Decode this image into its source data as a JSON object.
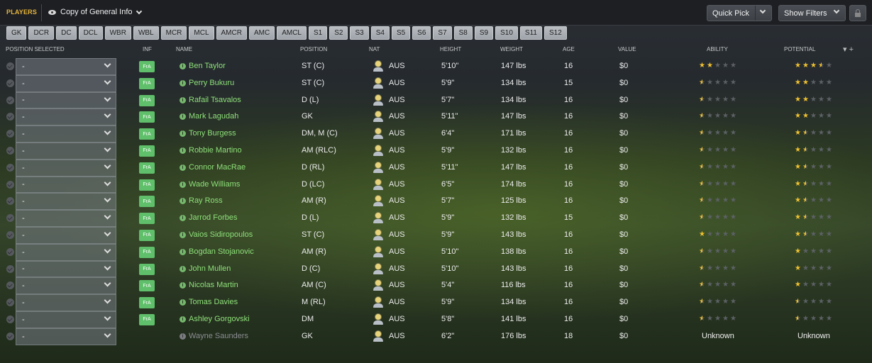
{
  "header": {
    "section": "PLAYERS",
    "view_name": "Copy of General Info",
    "quick_pick": "Quick Pick",
    "show_filters": "Show Filters"
  },
  "position_filters": [
    "GK",
    "DCR",
    "DC",
    "DCL",
    "WBR",
    "WBL",
    "MCR",
    "MCL",
    "AMCR",
    "AMC",
    "AMCL",
    "S1",
    "S2",
    "S3",
    "S4",
    "S5",
    "S6",
    "S7",
    "S8",
    "S9",
    "S10",
    "S11",
    "S12"
  ],
  "columns": {
    "position_selected": "POSITION SELECTED",
    "inf": "INF",
    "name": "NAME",
    "position": "POSITION",
    "nat": "NAT",
    "height": "HEIGHT",
    "weight": "WEIGHT",
    "age": "AGE",
    "value": "VALUE",
    "ability": "ABILITY",
    "potential": "POTENTIAL"
  },
  "accent_colors": {
    "header_label": "#e8b53a",
    "player_name": "#8ee07a",
    "star": "#f0c230",
    "inf_badge": "#5fbf6a"
  },
  "players": [
    {
      "selected": "-",
      "inf": "FrA",
      "name": "Ben Taylor",
      "position": "ST (C)",
      "nat": "AUS",
      "height": "5'10\"",
      "weight": "147 lbs",
      "age": "16",
      "value": "$0",
      "ability": 2,
      "potential": 3.5
    },
    {
      "selected": "-",
      "inf": "FrA",
      "name": "Perry Bukuru",
      "position": "ST (C)",
      "nat": "AUS",
      "height": "5'9\"",
      "weight": "134 lbs",
      "age": "15",
      "value": "$0",
      "ability": 0.5,
      "potential": 2
    },
    {
      "selected": "-",
      "inf": "FrA",
      "name": "Rafail Tsavalos",
      "position": "D (L)",
      "nat": "AUS",
      "height": "5'7\"",
      "weight": "134 lbs",
      "age": "16",
      "value": "$0",
      "ability": 0.5,
      "potential": 2
    },
    {
      "selected": "-",
      "inf": "FrA",
      "name": "Mark Lagudah",
      "position": "GK",
      "nat": "AUS",
      "height": "5'11\"",
      "weight": "147 lbs",
      "age": "16",
      "value": "$0",
      "ability": 0.5,
      "potential": 2
    },
    {
      "selected": "-",
      "inf": "FrA",
      "name": "Tony Burgess",
      "position": "DM, M (C)",
      "nat": "AUS",
      "height": "6'4\"",
      "weight": "171 lbs",
      "age": "16",
      "value": "$0",
      "ability": 0.5,
      "potential": 1.5
    },
    {
      "selected": "-",
      "inf": "FrA",
      "name": "Robbie Martino",
      "position": "AM (RLC)",
      "nat": "AUS",
      "height": "5'9\"",
      "weight": "132 lbs",
      "age": "16",
      "value": "$0",
      "ability": 0.5,
      "potential": 1.5
    },
    {
      "selected": "-",
      "inf": "FrA",
      "name": "Connor MacRae",
      "position": "D (RL)",
      "nat": "AUS",
      "height": "5'11\"",
      "weight": "147 lbs",
      "age": "16",
      "value": "$0",
      "ability": 0.5,
      "potential": 1.5
    },
    {
      "selected": "-",
      "inf": "FrA",
      "name": "Wade Williams",
      "position": "D (LC)",
      "nat": "AUS",
      "height": "6'5\"",
      "weight": "174 lbs",
      "age": "16",
      "value": "$0",
      "ability": 0.5,
      "potential": 1.5
    },
    {
      "selected": "-",
      "inf": "FrA",
      "name": "Ray Ross",
      "position": "AM (R)",
      "nat": "AUS",
      "height": "5'7\"",
      "weight": "125 lbs",
      "age": "16",
      "value": "$0",
      "ability": 0.5,
      "potential": 1.5
    },
    {
      "selected": "-",
      "inf": "FrA",
      "name": "Jarrod Forbes",
      "position": "D (L)",
      "nat": "AUS",
      "height": "5'9\"",
      "weight": "132 lbs",
      "age": "15",
      "value": "$0",
      "ability": 0.5,
      "potential": 1.5
    },
    {
      "selected": "-",
      "inf": "FrA",
      "name": "Vaios Sidiropoulos",
      "position": "ST (C)",
      "nat": "AUS",
      "height": "5'9\"",
      "weight": "143 lbs",
      "age": "16",
      "value": "$0",
      "ability": 1,
      "potential": 1.5
    },
    {
      "selected": "-",
      "inf": "FrA",
      "name": "Bogdan Stojanovic",
      "position": "AM (R)",
      "nat": "AUS",
      "height": "5'10\"",
      "weight": "138 lbs",
      "age": "16",
      "value": "$0",
      "ability": 0.5,
      "potential": 1
    },
    {
      "selected": "-",
      "inf": "FrA",
      "name": "John Mullen",
      "position": "D (C)",
      "nat": "AUS",
      "height": "5'10\"",
      "weight": "143 lbs",
      "age": "16",
      "value": "$0",
      "ability": 0.5,
      "potential": 1
    },
    {
      "selected": "-",
      "inf": "FrA",
      "name": "Nicolas Martin",
      "position": "AM (C)",
      "nat": "AUS",
      "height": "5'4\"",
      "weight": "116 lbs",
      "age": "16",
      "value": "$0",
      "ability": 0.5,
      "potential": 1
    },
    {
      "selected": "-",
      "inf": "FrA",
      "name": "Tomas Davies",
      "position": "M (RL)",
      "nat": "AUS",
      "height": "5'9\"",
      "weight": "134 lbs",
      "age": "16",
      "value": "$0",
      "ability": 0.5,
      "potential": 0.5
    },
    {
      "selected": "-",
      "inf": "FrA",
      "name": "Ashley Gorgovski",
      "position": "DM",
      "nat": "AUS",
      "height": "5'8\"",
      "weight": "141 lbs",
      "age": "16",
      "value": "$0",
      "ability": 0.5,
      "potential": 0.5
    },
    {
      "selected": "-",
      "inf": "",
      "name": "Wayne Saunders",
      "position": "GK",
      "nat": "AUS",
      "height": "6'2\"",
      "weight": "176 lbs",
      "age": "18",
      "value": "$0",
      "ability_text": "Unknown",
      "potential_text": "Unknown"
    }
  ]
}
